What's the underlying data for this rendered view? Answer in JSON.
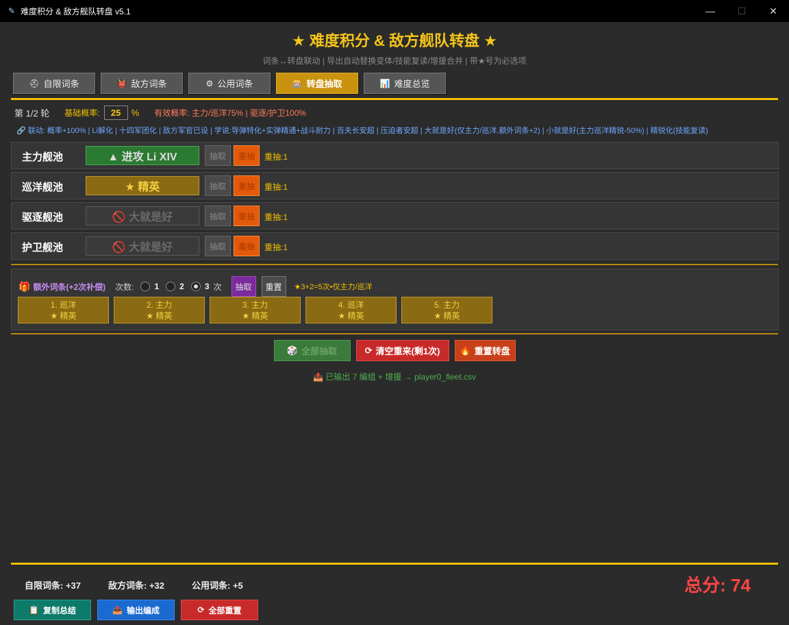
{
  "window": {
    "title": "难度积分 & 敌方舰队转盘 v5.1",
    "minimize": "—",
    "maximize": "☐",
    "close": "✕"
  },
  "header": {
    "title": "★ 难度积分 & 敌方舰队转盘 ★",
    "subtitle": "词条↔转盘联动 | 导出自动替换变体/技能复读/增援合并 | 带★号为必选项"
  },
  "tabs": [
    {
      "label": "自限词条",
      "icon": "helmet-icon"
    },
    {
      "label": "敌方词条",
      "icon": "demon-icon"
    },
    {
      "label": "公用词条",
      "icon": "gear-cluster-icon"
    },
    {
      "label": "转盘抽取",
      "icon": "slot-machine-icon"
    },
    {
      "label": "难度总览",
      "icon": "chart-icon"
    }
  ],
  "active_tab": "转盘抽取",
  "round": {
    "label": "第 1/2 轮",
    "base_label": "基础概率:",
    "base_value": "25",
    "pct": "%",
    "effective": "有效概率: 主力/巡洋75% | 驱逐/护卫100%"
  },
  "linkage": "🔗 联动: 概率+100% | Li解化 | 十四军团化 | 敌方军官已设 | 学说:导弹特化+实弹精通+战斗耐力 | 百夫长安超 | 压迫者安超 | 大就是好(仅主力/巡洋,额外词条+2) | 小就是好(主力巡洋精锐-50%) | 精锐化(技能复读)",
  "pools": [
    {
      "name": "主力舰池",
      "result": "▲ 进攻 Li XIV",
      "style": "green",
      "draw": "抽取",
      "redo": "重抽",
      "redo_count": "重抽:1"
    },
    {
      "name": "巡洋舰池",
      "result": "★ 精英",
      "style": "gold",
      "draw": "抽取",
      "redo": "重抽",
      "redo_count": "重抽:1"
    },
    {
      "name": "驱逐舰池",
      "result": "🚫 大就是好",
      "style": "gray",
      "draw": "抽取",
      "redo": "重抽",
      "redo_count": "重抽:1"
    },
    {
      "name": "护卫舰池",
      "result": "🚫 大就是好",
      "style": "gray",
      "draw": "抽取",
      "redo": "重抽",
      "redo_count": "重抽:1"
    }
  ],
  "extra": {
    "title": "额外词条(+2次补偿)",
    "count_label": "次数:",
    "options": [
      "1",
      "2",
      "3"
    ],
    "selected": "3",
    "times": "次",
    "draw": "抽取",
    "reset": "重置",
    "note": "★3+2=5次•仅主力/巡洋",
    "chips": [
      {
        "line1": "1. 巡洋",
        "line2": "★ 精英"
      },
      {
        "line1": "2. 主力",
        "line2": "★ 精英"
      },
      {
        "line1": "3. 主力",
        "line2": "★ 精英"
      },
      {
        "line1": "4. 巡洋",
        "line2": "★ 精英"
      },
      {
        "line1": "5. 主力",
        "line2": "★ 精英"
      }
    ]
  },
  "actions": {
    "draw_all": "全部抽取",
    "clear_restart": "清空重来(剩1次)",
    "reset_wheel": "重置转盘"
  },
  "output_msg": "📤 已输出 7 编组 + 增援 → player0_fleet.csv",
  "summary": {
    "self": "自限词条: +37",
    "enemy": "敌方词条: +32",
    "common": "公用词条: +5",
    "total": "总分: 74"
  },
  "bottom": {
    "copy": "复制总结",
    "export": "输出编成",
    "reset_all": "全部重置"
  },
  "colors": {
    "accent": "#f0c000",
    "total": "#ff4444",
    "link": "#6ea6ff",
    "ok": "#4caf50"
  }
}
